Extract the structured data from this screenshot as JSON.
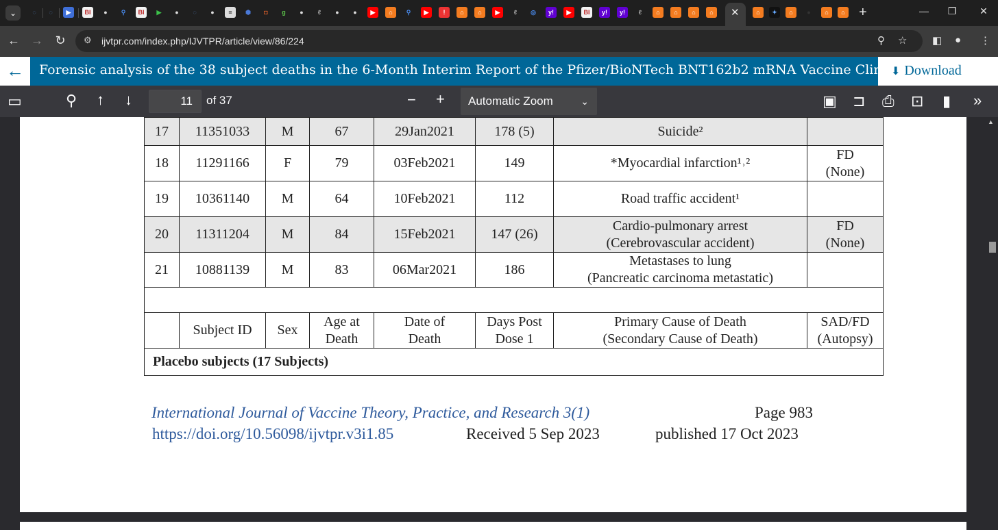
{
  "browser": {
    "url": "ijvtpr.com/index.php/IJVTPR/article/view/86/224",
    "tab_labels": [
      "BI",
      "BI",
      "BI",
      "y!",
      "y!"
    ],
    "new_tab": "+",
    "close": "✕"
  },
  "article": {
    "title": "Forensic analysis of the 38 subject deaths in the 6-Month Interim Report of the Pfizer/BioNTech BNT162b2 mRNA Vaccine Clinical Tr",
    "download_label": "Download"
  },
  "pdf_toolbar": {
    "page_number": "11",
    "page_count": "of 37",
    "zoom": "Automatic Zoom"
  },
  "table": {
    "rows": [
      {
        "no": "17",
        "subject_id": "11351033",
        "sex": "M",
        "age": "67",
        "date": "29Jan2021",
        "days": "178 (5)",
        "cause": "Suicide²",
        "cause2": "",
        "sad1": "",
        "sad2": "",
        "shade": true
      },
      {
        "no": "18",
        "subject_id": "11291166",
        "sex": "F",
        "age": "79",
        "date": "03Feb2021",
        "days": "149",
        "cause": "*Myocardial infarction¹˒²",
        "cause2": "",
        "sad1": "FD",
        "sad2": "(None)",
        "shade": false
      },
      {
        "no": "19",
        "subject_id": "10361140",
        "sex": "M",
        "age": "64",
        "date": "10Feb2021",
        "days": "112",
        "cause": "Road traffic accident¹",
        "cause2": "",
        "sad1": "",
        "sad2": "",
        "shade": false
      },
      {
        "no": "20",
        "subject_id": "11311204",
        "sex": "M",
        "age": "84",
        "date": "15Feb2021",
        "days": "147 (26)",
        "cause": "Cardio-pulmonary arrest",
        "cause2": "(Cerebrovascular accident)",
        "sad1": "FD",
        "sad2": "(None)",
        "shade": true
      },
      {
        "no": "21",
        "subject_id": "10881139",
        "sex": "M",
        "age": "83",
        "date": "06Mar2021",
        "days": "186",
        "cause": "Metastases to lung",
        "cause2": "(Pancreatic carcinoma metastatic)",
        "sad1": "",
        "sad2": "",
        "shade": false
      }
    ],
    "header": {
      "subject_id": "Subject ID",
      "sex": "Sex",
      "age_1": "Age at",
      "age_2": "Death",
      "date_1": "Date of",
      "date_2": "Death",
      "days_1": "Days Post",
      "days_2": "Dose 1",
      "cause_1": "Primary Cause of Death",
      "cause_2": "(Secondary Cause of Death)",
      "sad_1": "SAD/FD",
      "sad_2": "(Autopsy)"
    },
    "placebo_label": "Placebo subjects (17 Subjects)"
  },
  "footer": {
    "journal": "International Journal of Vaccine Theory, Practice, and Research 3(1)",
    "doi": "https://doi.org/10.56098/ijvtpr.v3i1.85",
    "received": "Received 5 Sep 2023",
    "page": "Page 983",
    "published": "published 17 Oct 2023"
  },
  "colors": {
    "title_bar": "#006798",
    "pdf_toolbar": "#38383d",
    "viewer_bg": "#2a2a2e",
    "row_shade": "#e6e6e6",
    "journal_link": "#2e5a9c"
  }
}
